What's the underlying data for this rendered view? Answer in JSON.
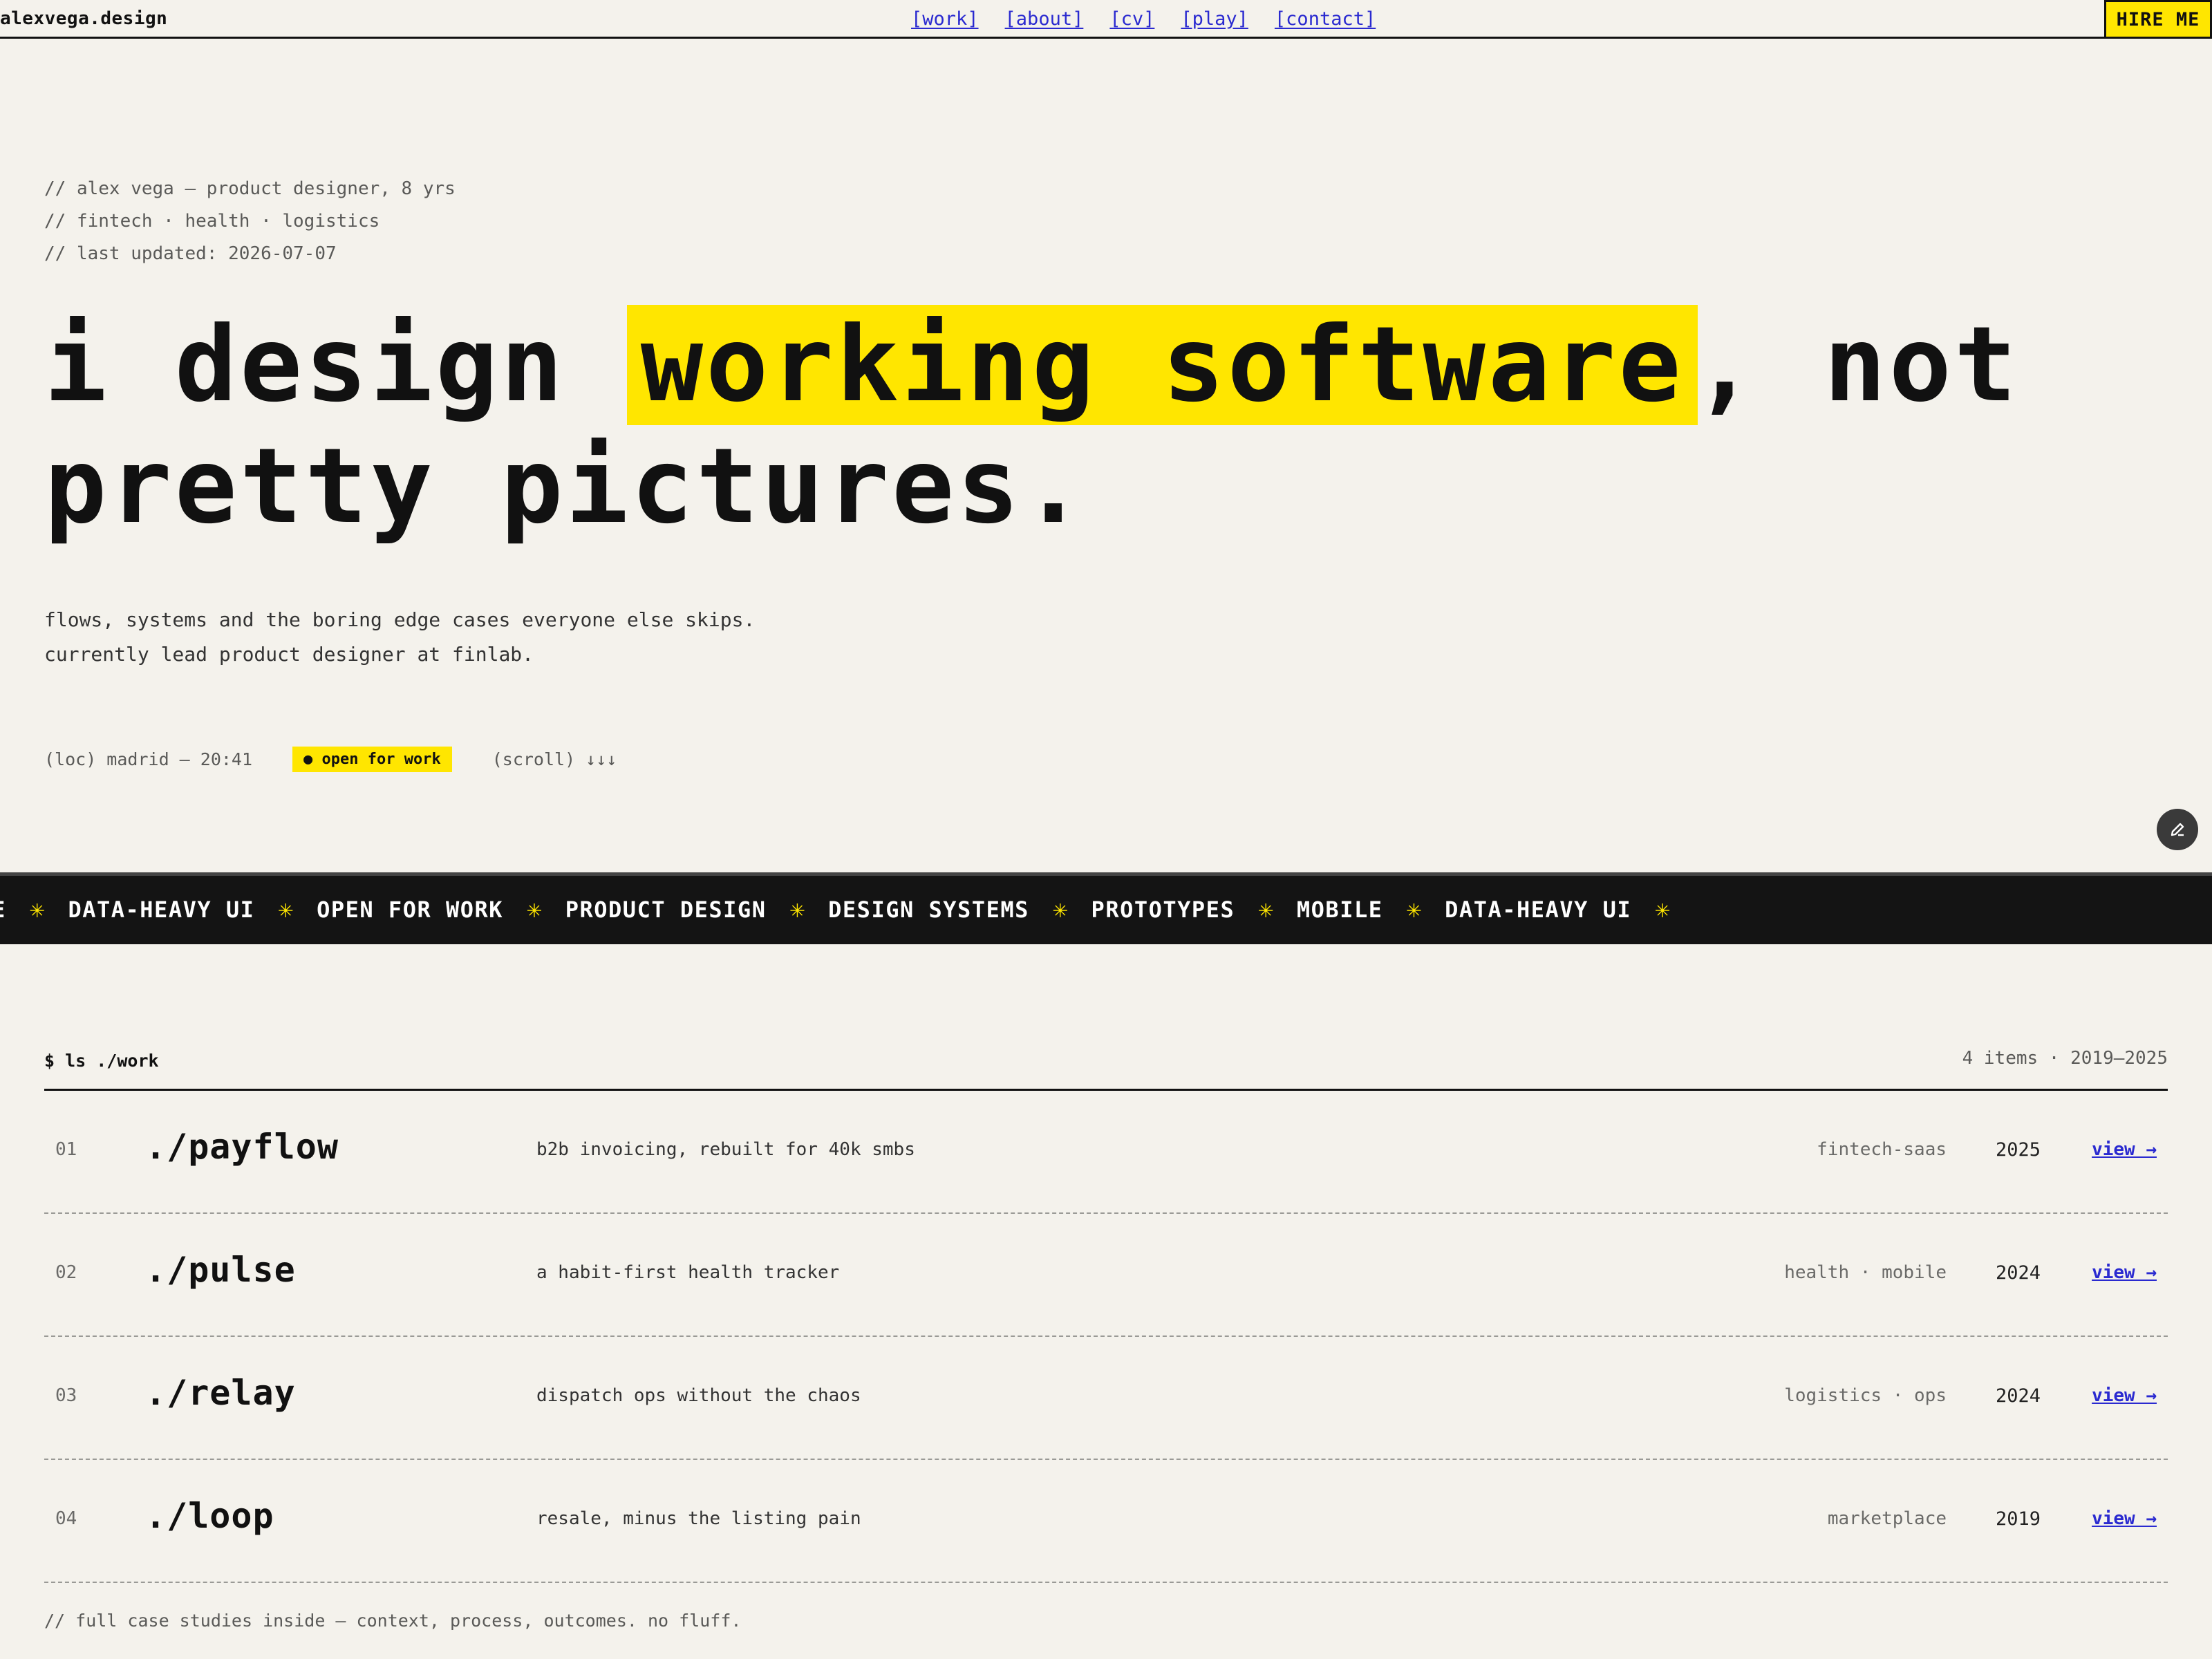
{
  "nav": {
    "brand": "alexvega.design",
    "links": [
      "[work]",
      "[about]",
      "[cv]",
      "[play]",
      "[contact]"
    ],
    "cta": "HIRE ME"
  },
  "hero": {
    "meta": [
      "// alex vega — product designer, 8 yrs",
      "// fintech · health · logistics",
      "// last updated: 2026-07-07"
    ],
    "headline_pre": "i design ",
    "headline_highlight": "working software",
    "headline_post": ", not pretty pictures.",
    "sub": [
      "flows, systems and the boring edge cases everyone else skips.",
      "currently lead product designer at finlab."
    ],
    "location": "(loc) madrid — 20:41",
    "availability": "● open for work",
    "scroll_hint": "(scroll) ↓↓↓"
  },
  "marquee": {
    "lead_fragment": "E",
    "items": [
      "DATA-HEAVY UI",
      "OPEN FOR WORK",
      "PRODUCT DESIGN",
      "DESIGN SYSTEMS",
      "PROTOTYPES",
      "MOBILE",
      "DATA-HEAVY UI"
    ],
    "separator": "✳"
  },
  "work": {
    "prompt": "$ ls ./work",
    "count": "4 items · 2019—2025",
    "projects": [
      {
        "num": "01",
        "name": "./payflow",
        "desc": "b2b invoicing, rebuilt for 40k smbs",
        "tag": "fintech-saas",
        "year": "2025",
        "link": "view →"
      },
      {
        "num": "02",
        "name": "./pulse",
        "desc": "a habit-first health tracker",
        "tag": "health · mobile",
        "year": "2024",
        "link": "view →"
      },
      {
        "num": "03",
        "name": "./relay",
        "desc": "dispatch ops without the chaos",
        "tag": "logistics · ops",
        "year": "2024",
        "link": "view →"
      },
      {
        "num": "04",
        "name": "./loop",
        "desc": "resale, minus the listing pain",
        "tag": "marketplace",
        "year": "2019",
        "link": "view →"
      }
    ],
    "footnote": "// full case studies inside — context, process, outcomes. no fluff."
  },
  "colors": {
    "accent": "#ffe600",
    "link": "#2a2ad0",
    "band": "#141414",
    "background": "#f4f2ec"
  },
  "icons": {
    "edit": "pencil-icon"
  }
}
